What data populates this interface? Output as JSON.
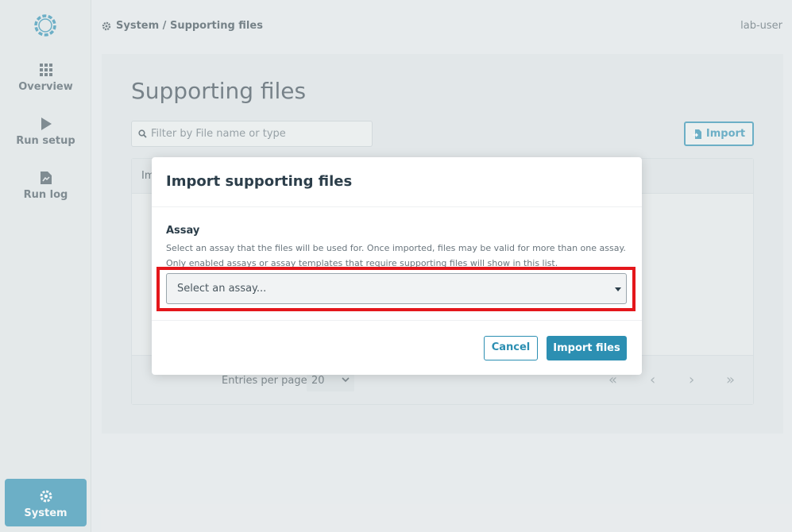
{
  "sidebar": {
    "items": [
      {
        "label": "Overview",
        "icon": "grid-icon"
      },
      {
        "label": "Run setup",
        "icon": "play-icon"
      },
      {
        "label": "Run log",
        "icon": "document-icon"
      }
    ],
    "system": {
      "label": "System",
      "icon": "gear-icon"
    }
  },
  "header": {
    "breadcrumb": "System / Supporting files",
    "user": "lab-user"
  },
  "page": {
    "title": "Supporting files",
    "filter_placeholder": "Filter by File name or type",
    "import_label": "Import",
    "table_header_partial": "Im",
    "entries_label": "Entries per page",
    "entries_value": "20",
    "pager": {
      "first": "«",
      "prev": "‹",
      "next": "›",
      "last": "»"
    }
  },
  "modal": {
    "title": "Import supporting files",
    "field_label": "Assay",
    "help_text_1": "Select an assay that the files will be used for. Once imported, files may be valid for more than one assay.",
    "help_text_2": "Only enabled assays or assay templates that require supporting files will show in this list.",
    "select_placeholder": "Select an assay...",
    "cancel_label": "Cancel",
    "import_files_label": "Import files"
  },
  "colors": {
    "accent": "#2c8fb2",
    "highlight": "#e4161b"
  }
}
